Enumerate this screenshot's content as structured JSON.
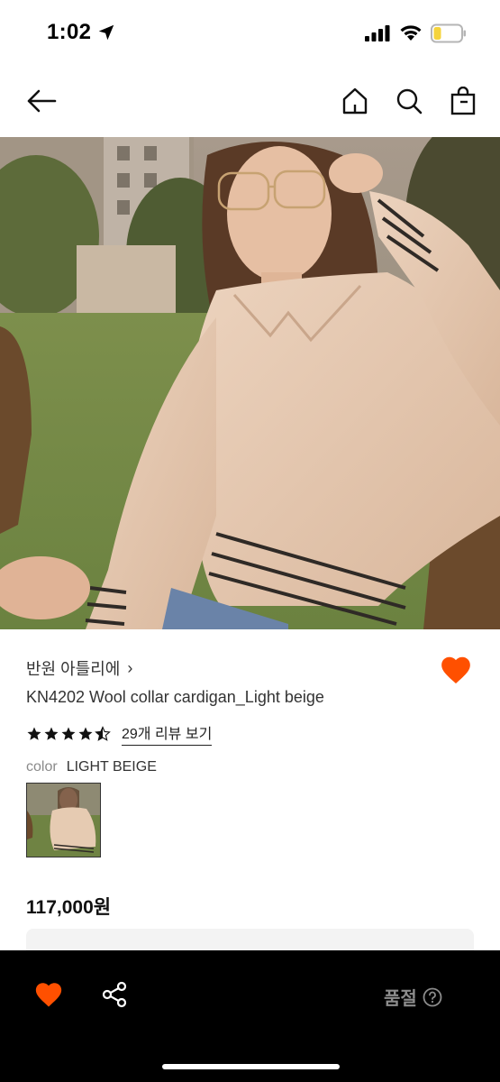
{
  "status_bar": {
    "time": "1:02",
    "icons": [
      "location-arrow-icon",
      "cellular-signal-icon",
      "wifi-icon",
      "battery-icon"
    ]
  },
  "nav": {
    "icons": [
      "back-arrow-icon",
      "home-icon",
      "search-icon",
      "shopping-bag-icon"
    ]
  },
  "hero": {
    "icon": "product-photo"
  },
  "product": {
    "brand": "반원 아틀리에",
    "brand_chevron": "›",
    "name": "KN4202 Wool collar cardigan_Light beige",
    "rating": 4.5,
    "review_link": "29개 리뷰 보기",
    "color_label": "color",
    "color_value": "LIGHT BEIGE",
    "price": "117,000원",
    "wish_color": "#ff5000"
  },
  "bottom_bar": {
    "soldout_label": "품절",
    "icons": [
      "heart-icon",
      "share-icon",
      "help-circle-icon"
    ],
    "heart_color": "#ff5000",
    "background": "#000000"
  }
}
